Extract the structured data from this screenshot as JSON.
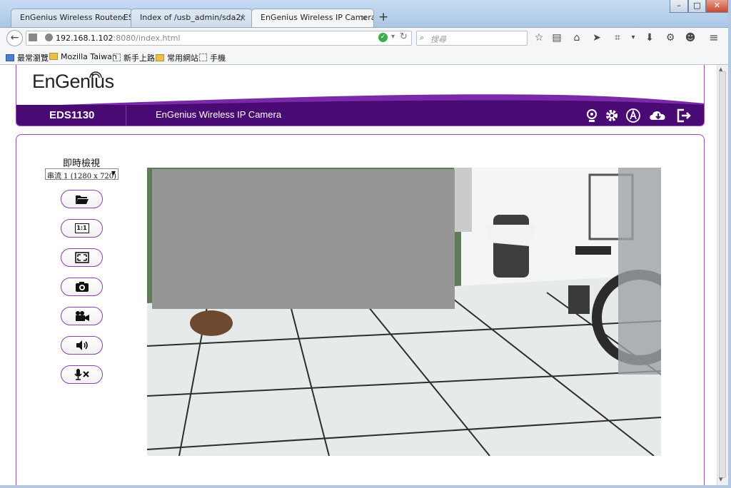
{
  "browser": {
    "tabs": [
      {
        "label": "EnGenius Wireless Router ES...",
        "close": "×"
      },
      {
        "label": "Index of /usb_admin/sda2/",
        "close": "×"
      },
      {
        "label": "EnGenius Wireless IP Camera",
        "close": "×"
      }
    ],
    "new_tab": "+",
    "url_host": "192.168.1.102",
    "url_rest": ":8080/index.html",
    "search_placeholder": "搜尋",
    "window_buttons": [
      "–",
      "□",
      "✕"
    ],
    "bookmarks": [
      {
        "label": "最常瀏覽",
        "icon": "most-visited-icon"
      },
      {
        "label": "Mozilla Taiwan",
        "icon": "folder-icon"
      },
      {
        "label": "新手上路",
        "icon": "blank-page-icon"
      },
      {
        "label": "常用網站",
        "icon": "folder-icon"
      },
      {
        "label": "手機",
        "icon": "blank-page-icon"
      }
    ]
  },
  "app": {
    "logo": "EnGenius",
    "model": "EDS1130",
    "title": "EnGenius Wireless IP Camera",
    "header_icons": [
      "webcam-icon",
      "settings-gear-icon",
      "admin-a-icon",
      "cloud-download-icon",
      "logout-icon"
    ],
    "accent_color": "#4a0a73"
  },
  "live_view": {
    "heading": "即時檢視",
    "stream_select": "串流 1 (1280 x 720)",
    "controls": [
      "open-folder-icon",
      "one-to-one-icon",
      "fullscreen-icon",
      "snapshot-camera-icon",
      "record-video-icon",
      "speaker-icon",
      "mic-mute-icon"
    ],
    "control_label_1to1": "1:1"
  }
}
